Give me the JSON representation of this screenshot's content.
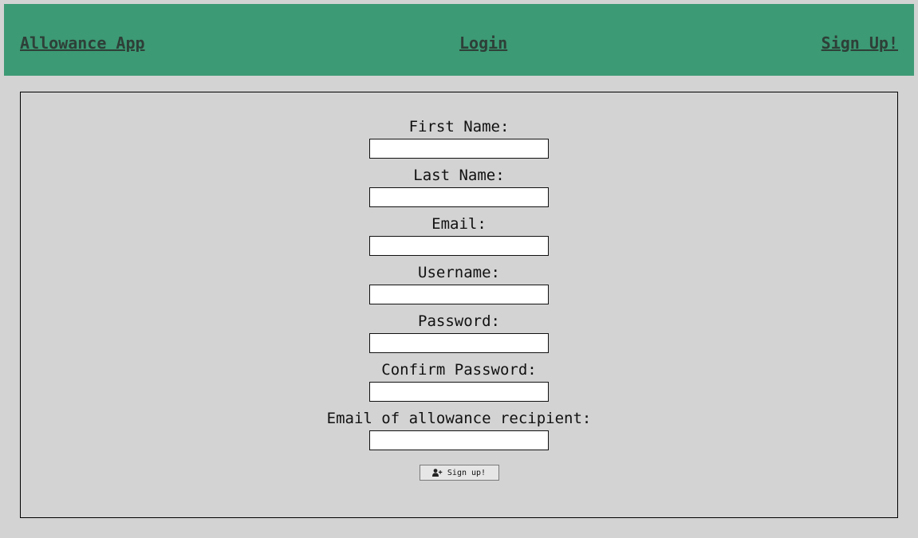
{
  "nav": {
    "brand": "Allowance App",
    "login": "Login",
    "signup": "Sign Up!"
  },
  "form": {
    "fields": [
      {
        "label": "First Name:",
        "value": ""
      },
      {
        "label": "Last Name:",
        "value": ""
      },
      {
        "label": "Email:",
        "value": ""
      },
      {
        "label": "Username:",
        "value": ""
      },
      {
        "label": "Password:",
        "value": ""
      },
      {
        "label": "Confirm Password:",
        "value": ""
      },
      {
        "label": "Email of allowance recipient:",
        "value": ""
      }
    ],
    "submit": {
      "label": "Sign up!",
      "icon": "user-plus-icon"
    }
  },
  "colors": {
    "navbar_bg": "#3c9a74",
    "nav_link": "#2e3f38",
    "page_bg": "#d3d3d3"
  }
}
